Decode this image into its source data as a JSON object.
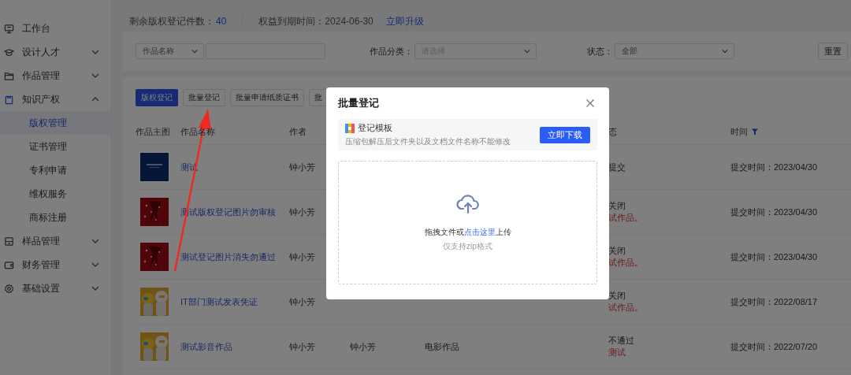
{
  "sidebar": {
    "items": [
      {
        "label": "工作台",
        "selected": false
      },
      {
        "label": "设计人才",
        "selected": false,
        "expanded": false
      },
      {
        "label": "作品管理",
        "selected": false,
        "expanded": false
      },
      {
        "label": "知识产权",
        "selected": false,
        "expanded": true,
        "children": [
          {
            "label": "版权管理",
            "selected": true
          },
          {
            "label": "证书管理",
            "selected": false
          },
          {
            "label": "专利申请",
            "selected": false
          },
          {
            "label": "维权服务",
            "selected": false
          },
          {
            "label": "商标注册",
            "selected": false
          }
        ]
      },
      {
        "label": "样品管理",
        "selected": false,
        "expanded": false
      },
      {
        "label": "财务管理",
        "selected": false,
        "expanded": false
      },
      {
        "label": "基础设置",
        "selected": false,
        "expanded": false
      }
    ]
  },
  "summary": {
    "remaining_label": "剩余版权登记件数：",
    "remaining_count": "40",
    "expiry": "权益到期时间：2024-06-30",
    "upgrade_link": "立即升级"
  },
  "filters": {
    "name_select": "作品名称",
    "category_label": "作品分类：",
    "category_placeholder": "请选择",
    "status_label": "状态：",
    "status_value": "全部",
    "reset_button": "重置"
  },
  "toolbar": [
    {
      "label": "版权登记",
      "kind": "primary"
    },
    {
      "label": "批量登记",
      "kind": "default"
    },
    {
      "label": "批量申请纸质证书",
      "kind": "default"
    },
    {
      "label": "批",
      "kind": "default"
    }
  ],
  "table": {
    "columns": [
      {
        "label": "作品主图"
      },
      {
        "kind": "name",
        "label": "作品名称"
      },
      {
        "kind": "author",
        "label": "作者"
      },
      {
        "kind": "status",
        "label": "态"
      },
      {
        "kind": "time",
        "label": "时间"
      }
    ],
    "rows": [
      {
        "name": "测试",
        "author": "钟小芳",
        "status": "提交",
        "time": "提交时间：2023/04/30"
      },
      {
        "name": "测试版权登记图片勿审核",
        "author": "钟小芳",
        "status": "关闭",
        "status_note": "试作品。",
        "time": "提交时间：2023/04/30"
      },
      {
        "name": "测试登记图片消失勿通过",
        "author": "钟小芳",
        "status": "关闭",
        "status_note": "试作品。",
        "time": "提交时间：2023/04/30"
      },
      {
        "name": "IT部门测试发表凭证",
        "author": "钟小芳",
        "status": "关闭",
        "status_note": "试作品。",
        "time": "提交时间：2022/08/17"
      },
      {
        "name": "测试影音作品",
        "author": "钟小芳",
        "column_4": "钟小芳",
        "column_5": "电影作品",
        "status": "不通过",
        "status_note": "测试",
        "time": "提交时间：2022/07/20"
      }
    ]
  },
  "modal": {
    "title": "批量登记",
    "template": {
      "title": "登记模板",
      "hint": "压缩包解压后文件夹以及文档文件名称不能修改",
      "download_button": "立即下载"
    },
    "upload": {
      "prompt_before": "拖拽文件或",
      "prompt_link": "点击这里",
      "prompt_after": "上传",
      "hint": "仅支持zip格式"
    }
  }
}
